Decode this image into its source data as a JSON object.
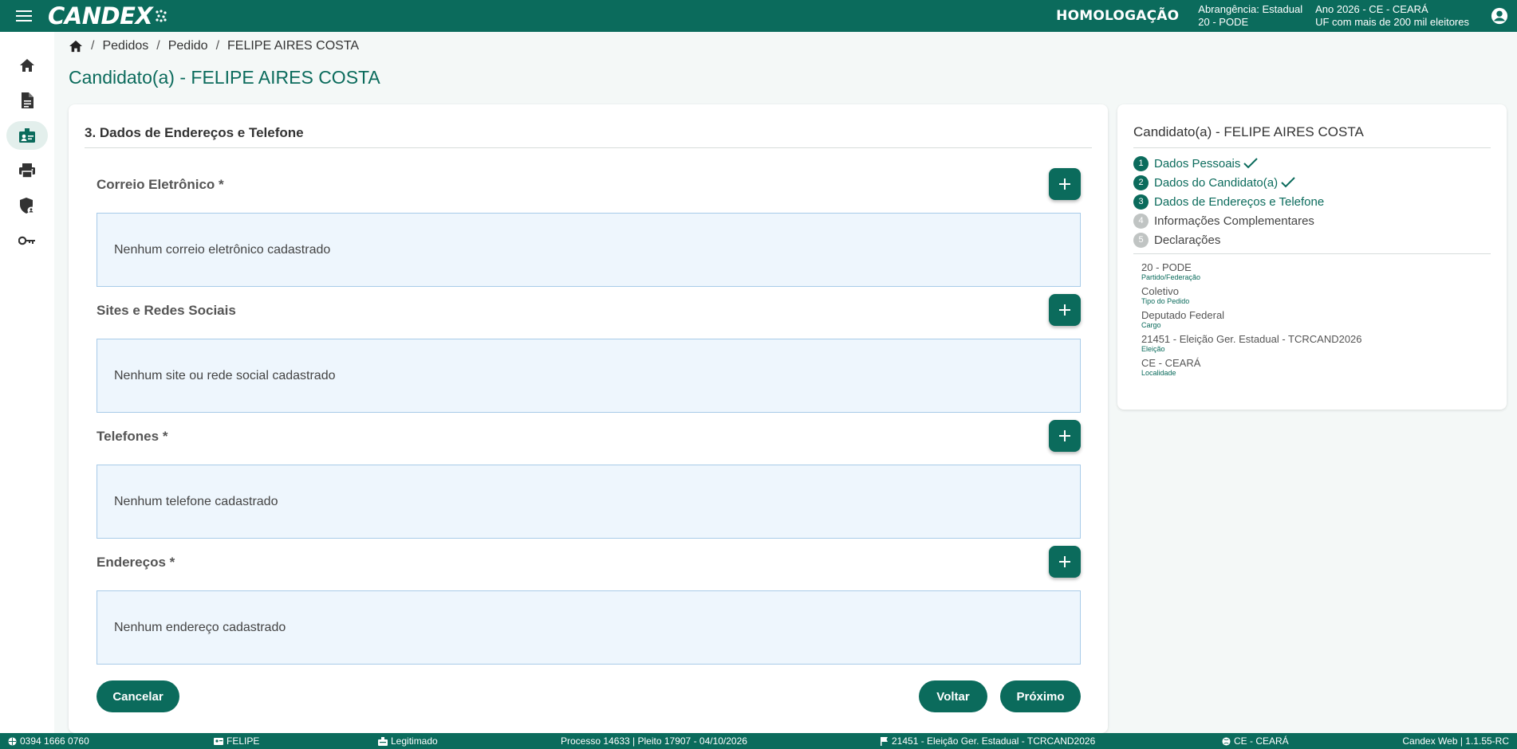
{
  "header": {
    "logo": "CANDEX",
    "environment": "HOMOLOGAÇÃO",
    "scope_line1": "Abrangência: Estadual",
    "scope_line2": "20 - PODE",
    "year_line1": "Ano 2026 - CE - CEARÁ",
    "year_line2": "UF com mais de 200 mil eleitores",
    "icons": {
      "menu": "menu-icon",
      "user": "account-circle-icon"
    }
  },
  "sidebar": {
    "items": [
      {
        "name": "home",
        "icon": "home-icon",
        "active": false
      },
      {
        "name": "documents",
        "icon": "document-icon",
        "active": false
      },
      {
        "name": "candidate",
        "icon": "candidate-badge-icon",
        "active": true
      },
      {
        "name": "print",
        "icon": "printer-icon",
        "active": false
      },
      {
        "name": "security",
        "icon": "shield-user-icon",
        "active": false
      },
      {
        "name": "key",
        "icon": "key-icon",
        "active": false
      }
    ]
  },
  "breadcrumb": {
    "items": [
      "Pedidos",
      "Pedido",
      "FELIPE AIRES COSTA"
    ],
    "separator": "/"
  },
  "page": {
    "title": "Candidato(a) - FELIPE AIRES COSTA"
  },
  "form": {
    "section_title": "3. Dados de Endereços e Telefone",
    "email": {
      "label": "Correio Eletrônico *",
      "empty": "Nenhum correio eletrônico cadastrado"
    },
    "sites": {
      "label": "Sites e Redes Sociais",
      "empty": "Nenhum site ou rede social cadastrado"
    },
    "phones": {
      "label": "Telefones *",
      "empty": "Nenhum telefone cadastrado"
    },
    "addresses": {
      "label": "Endereços *",
      "empty": "Nenhum endereço cadastrado"
    },
    "buttons": {
      "cancel": "Cancelar",
      "back": "Voltar",
      "next": "Próximo"
    }
  },
  "summary": {
    "title": "Candidato(a) - FELIPE AIRES COSTA",
    "steps": [
      {
        "num": "1",
        "label": "Dados Pessoais",
        "status": "done"
      },
      {
        "num": "2",
        "label": "Dados do Candidato(a)",
        "status": "done"
      },
      {
        "num": "3",
        "label": "Dados de Endereços e Telefone",
        "status": "current"
      },
      {
        "num": "4",
        "label": "Informações Complementares",
        "status": "pending"
      },
      {
        "num": "5",
        "label": "Declarações",
        "status": "pending"
      }
    ],
    "meta": [
      {
        "value": "20 - PODE",
        "caption": "Partido/Federação"
      },
      {
        "value": "Coletivo",
        "caption": "Tipo do Pedido"
      },
      {
        "value": "Deputado Federal",
        "caption": "Cargo"
      },
      {
        "value": "21451 - Eleição Ger. Estadual - TCRCAND2026",
        "caption": "Eleição"
      },
      {
        "value": "CE - CEARÁ",
        "caption": "Localidade"
      }
    ]
  },
  "footer": {
    "phone": "0394 1666 0760",
    "user": "FELIPE",
    "status": "Legitimado",
    "process": "Processo 14633 | Pleito 17907 - 04/10/2026",
    "election": "21451 - Eleição Ger. Estadual - TCRCAND2026",
    "locale": "CE - CEARÁ",
    "version": "Candex Web | 1.1.55-RC"
  },
  "colors": {
    "primary": "#0b6b5c",
    "empty_box_bg": "#eef6fd",
    "empty_box_border": "#a8cbe8",
    "page_bg": "#f4f8f7"
  }
}
